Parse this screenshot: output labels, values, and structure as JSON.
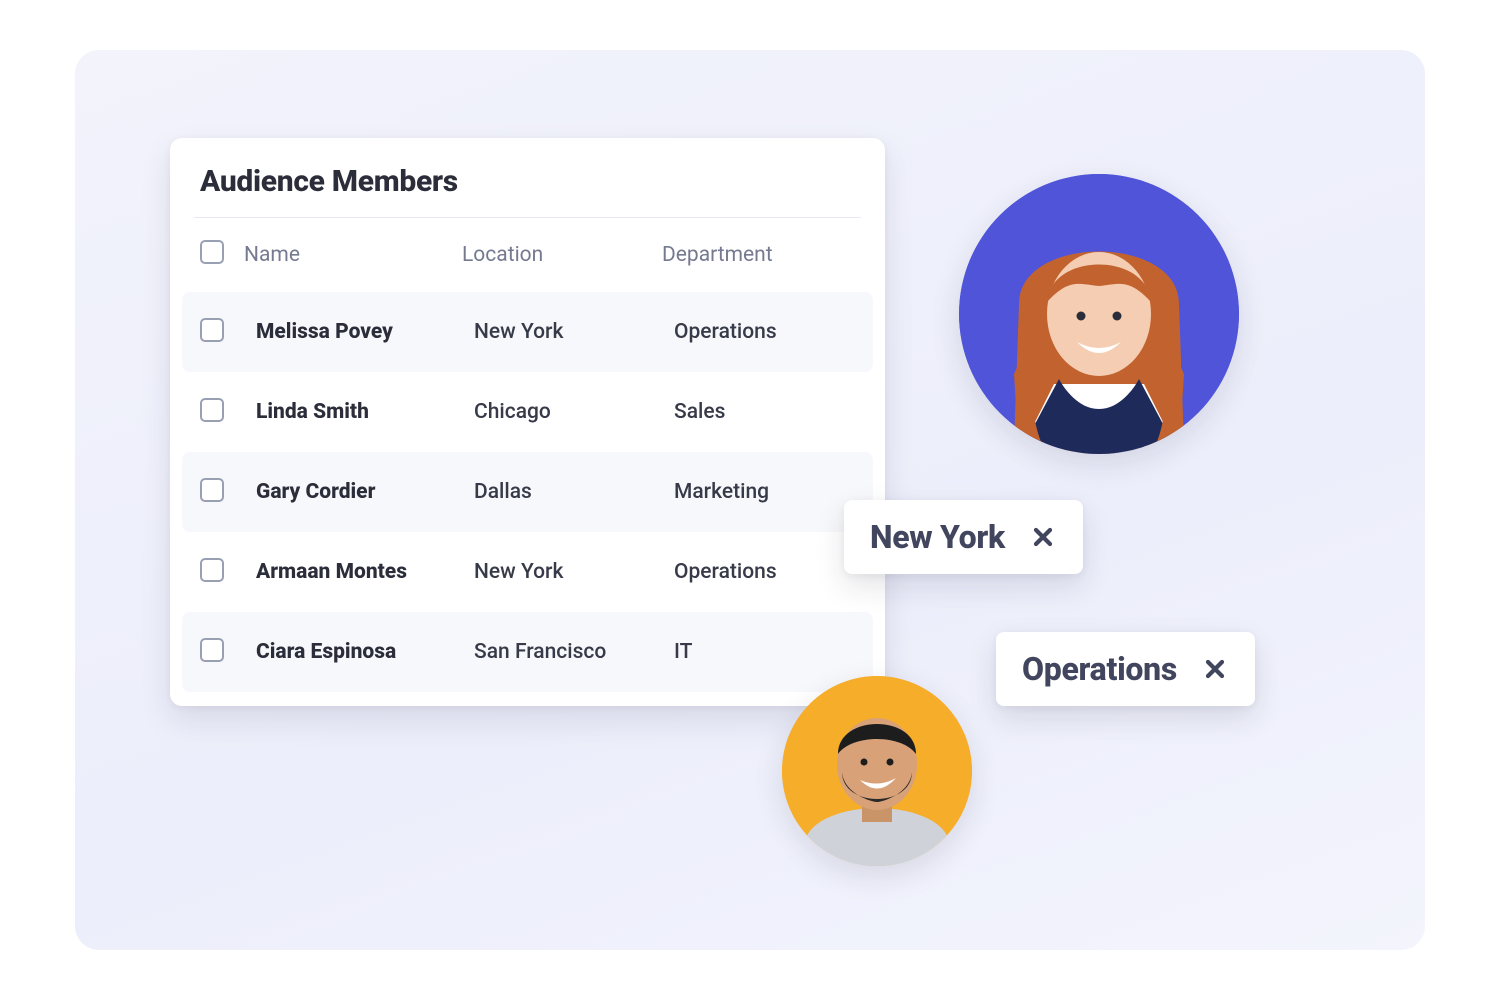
{
  "card": {
    "title": "Audience Members",
    "columns": {
      "name": "Name",
      "location": "Location",
      "department": "Department"
    },
    "rows": [
      {
        "name": "Melissa Povey",
        "location": "New York",
        "department": "Operations"
      },
      {
        "name": "Linda Smith",
        "location": "Chicago",
        "department": "Sales"
      },
      {
        "name": "Gary Cordier",
        "location": "Dallas",
        "department": "Marketing"
      },
      {
        "name": "Armaan Montes",
        "location": "New York",
        "department": "Operations"
      },
      {
        "name": "Ciara Espinosa",
        "location": "San Francisco",
        "department": "IT"
      }
    ]
  },
  "chips": [
    {
      "label": "New York"
    },
    {
      "label": "Operations"
    }
  ]
}
